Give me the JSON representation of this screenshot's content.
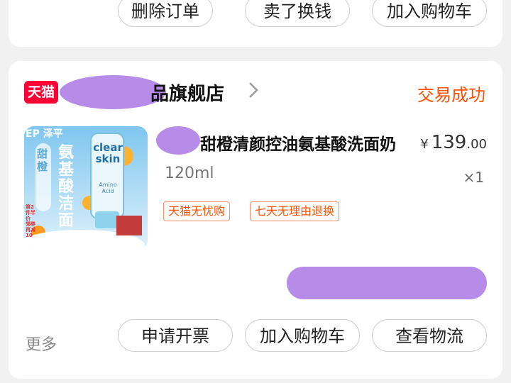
{
  "top_order": {
    "buttons": [
      {
        "label": "删除订单"
      },
      {
        "label": "卖了换钱"
      },
      {
        "label": "加入购物车"
      }
    ]
  },
  "order": {
    "shop_badge": "天猫",
    "store_name": "品旗舰店",
    "status": "交易成功",
    "product": {
      "title": "甜橙清颜控油氨基酸洗面奶",
      "price_currency": "¥",
      "price_integer": "139",
      "price_decimal": ".00",
      "variant": "120ml",
      "quantity": "×1",
      "image_text": {
        "brand": "clear skin",
        "logo": "EP 泽平",
        "side_text": "甜橙",
        "main_text": "氨基酸洁面",
        "tube_label": "Amino Acid",
        "promo": "第2件半价 领券再减10"
      }
    },
    "tags": [
      "天猫无忧购",
      "七天无理由退换"
    ],
    "more_label": "更多",
    "actions": [
      {
        "label": "申请开票"
      },
      {
        "label": "加入购物车"
      },
      {
        "label": "查看物流"
      }
    ]
  },
  "colors": {
    "accent": "#ff5000",
    "tmall_red": "#ff0036",
    "redaction": "#b78be8",
    "background": "#f1f1f1"
  }
}
